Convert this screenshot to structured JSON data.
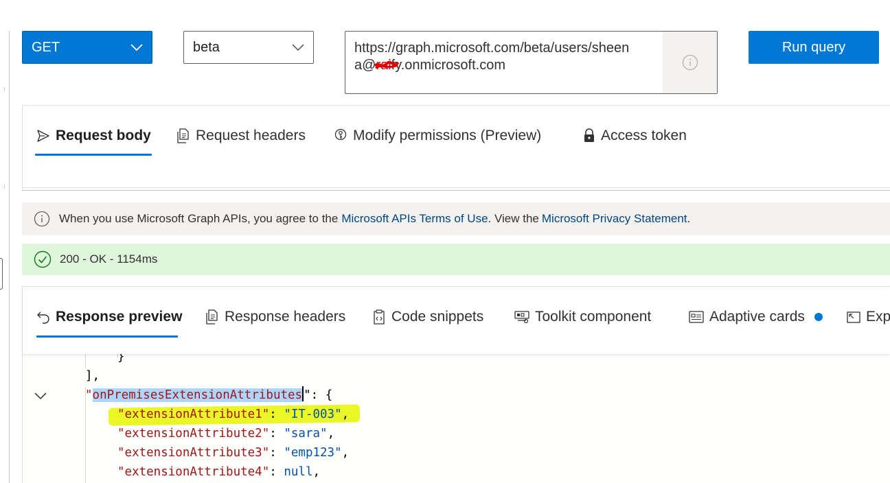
{
  "query": {
    "method": "GET",
    "version": "beta",
    "url_line1": "https://graph.microsoft.com/beta/users/sheen",
    "url_line2_prefix": "a@",
    "url_redacted": "rai",
    "url_line2_suffix": "fy.onmicrosoft.com",
    "run_label": "Run query"
  },
  "request_tabs": [
    {
      "label": "Request body",
      "icon": "send-icon",
      "active": true
    },
    {
      "label": "Request headers",
      "icon": "document-icon",
      "active": false
    },
    {
      "label": "Modify permissions (Preview)",
      "icon": "permission-key-icon",
      "active": false
    },
    {
      "label": "Access token",
      "icon": "lock-icon",
      "active": false
    }
  ],
  "notice": {
    "text1": "When you use Microsoft Graph APIs, you agree to the",
    "link1": "Microsoft APIs Terms of Use",
    "text2": ". View the",
    "link2": "Microsoft Privacy Statement",
    "text3": "."
  },
  "status": {
    "text": "200 - OK - 1154ms",
    "color": "#dff6dd"
  },
  "response_tabs": [
    {
      "label": "Response preview",
      "icon": "undo-arrow-icon",
      "active": true
    },
    {
      "label": "Response headers",
      "icon": "document-icon",
      "active": false
    },
    {
      "label": "Code snippets",
      "icon": "clipboard-code-icon",
      "active": false
    },
    {
      "label": "Toolkit component",
      "icon": "toolkit-icon",
      "active": false
    },
    {
      "label": "Adaptive cards",
      "icon": "card-icon",
      "active": false
    },
    {
      "label": "Expa",
      "icon": "expand-icon",
      "active": false
    }
  ],
  "json_preview": {
    "closing_brace": "}",
    "closing_bracket": "],",
    "object_key": "onPremisesExtensionAttributes",
    "object_open": "\": {",
    "attributes": [
      {
        "key": "\"extensionAttribute1\"",
        "value": "\"IT-003\"",
        "suffix": ","
      },
      {
        "key": "\"extensionAttribute2\"",
        "value": "\"sara\"",
        "suffix": ","
      },
      {
        "key": "\"extensionAttribute3\"",
        "value": "\"emp123\"",
        "suffix": ","
      },
      {
        "key": "\"extensionAttribute4\"",
        "value": "null",
        "suffix": ","
      }
    ]
  },
  "colors": {
    "accent": "#0078d4",
    "highlight_marker": "#e8f400",
    "json_key": "#a31515",
    "json_value": "#0451a5"
  }
}
